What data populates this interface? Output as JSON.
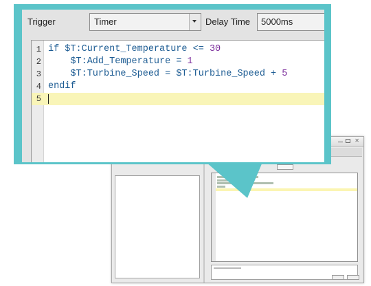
{
  "editor_panel": {
    "trigger_label": "Trigger",
    "trigger_value": "Timer",
    "delay_label": "Delay Time",
    "delay_value": "5000ms",
    "code_lines": [
      {
        "num": "1",
        "text": "if $T:Current_Temperature <= 30"
      },
      {
        "num": "2",
        "text": "    $T:Add_Temperature = 1"
      },
      {
        "num": "3",
        "text": "    $T:Turbine_Speed = $T:Turbine_Speed + 5"
      },
      {
        "num": "4",
        "text": "endif"
      },
      {
        "num": "5",
        "text": ""
      }
    ],
    "current_line": 5
  },
  "colors": {
    "callout_frame": "#5bc4c9",
    "current_line_highlight": "#f9f5b8",
    "code_text": "#1d5c93",
    "number_literal": "#7a2b9a"
  },
  "icons": [
    "chevron-down-icon",
    "minimize-icon",
    "maximize-icon",
    "close-icon"
  ]
}
